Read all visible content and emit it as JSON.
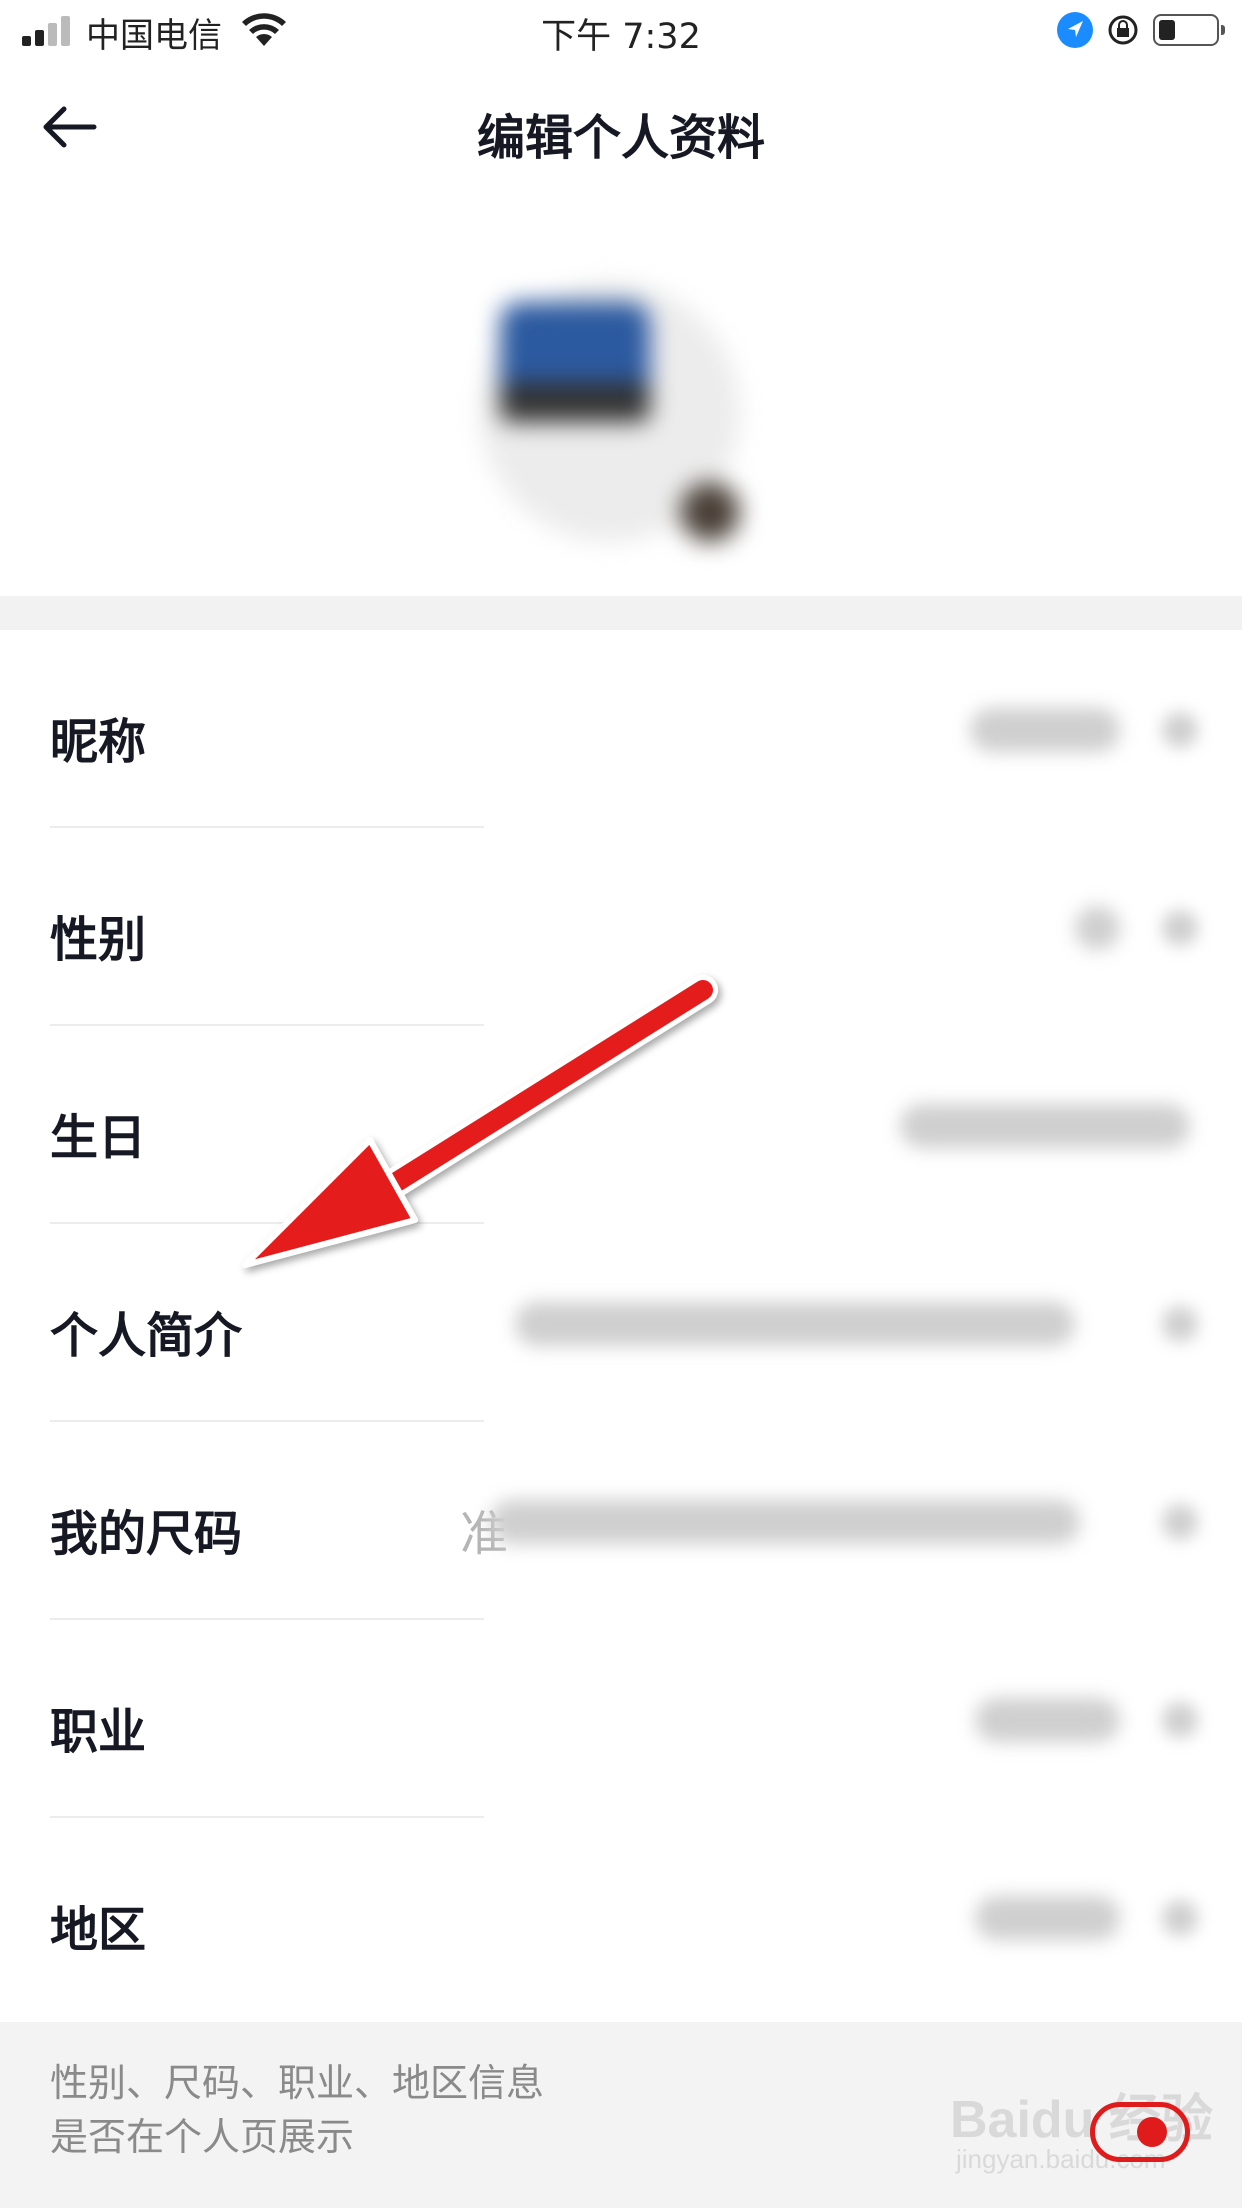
{
  "status_bar": {
    "carrier": "中国电信",
    "time": "下午 7:32"
  },
  "nav": {
    "title": "编辑个人资料",
    "back_icon": "arrow-left-icon"
  },
  "profile_rows": [
    {
      "label": "昵称"
    },
    {
      "label": "性别"
    },
    {
      "label": "生日"
    },
    {
      "label": "个人简介"
    },
    {
      "label": "我的尺码",
      "value_hint": "准"
    },
    {
      "label": "职业"
    },
    {
      "label": "地区"
    }
  ],
  "footer": {
    "note_line1": "性别、尺码、职业、地区信息",
    "note_line2": "是否在个人页展示",
    "toggle_on": true,
    "watermark_main": "Baidu 经验",
    "watermark_sub": "jingyan.baidu.com"
  },
  "annotation": {
    "arrow_color": "#e51a1a",
    "points_to": "个人简介"
  }
}
